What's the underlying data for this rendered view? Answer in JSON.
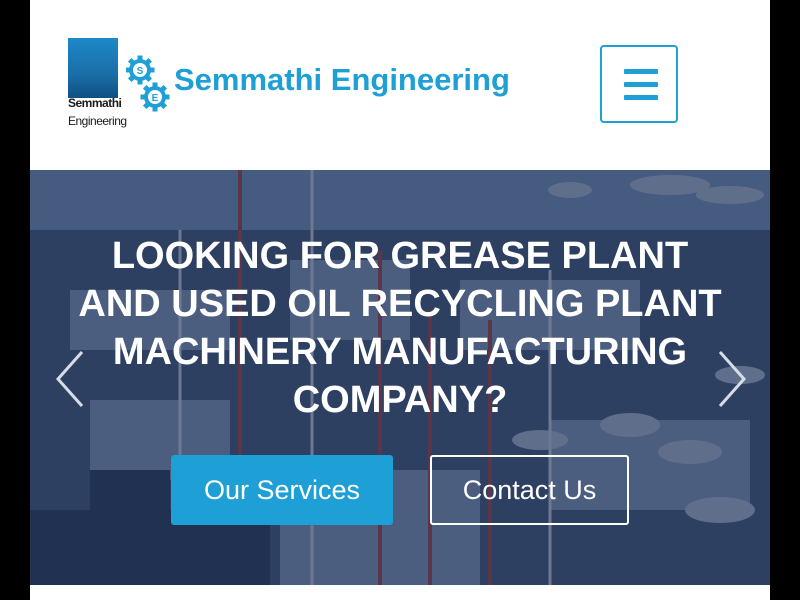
{
  "header": {
    "logo_line1": "Semmathi",
    "logo_line2": "Engineering",
    "gear_letters": [
      "S",
      "E"
    ],
    "brand_name": "Semmathi Engineering",
    "menu_icon": "hamburger-menu-icon"
  },
  "hero": {
    "headline_lines": [
      "LOOKING FOR GREASE PLANT",
      "AND USED OIL RECYCLING PLANT",
      "MACHINERY MANUFACTURING",
      "COMPANY?"
    ],
    "primary_button": "Our Services",
    "secondary_button": "Contact Us",
    "prev_icon": "chevron-left-icon",
    "next_icon": "chevron-right-icon"
  },
  "colors": {
    "brand_blue": "#1e9fd6",
    "hero_overlay": "#16264e",
    "white": "#ffffff"
  }
}
